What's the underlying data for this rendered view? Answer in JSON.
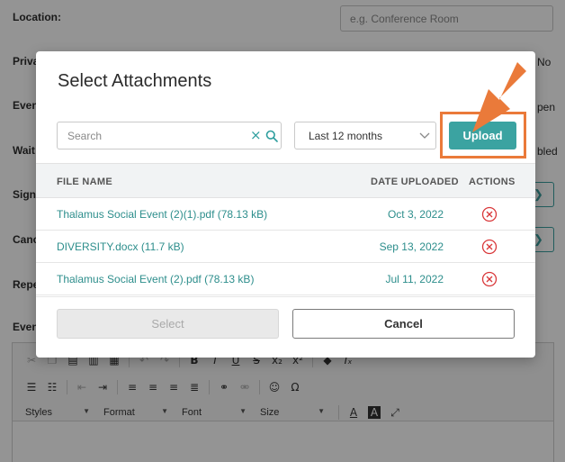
{
  "background": {
    "location_label": "Location:",
    "location_placeholder": "e.g. Conference Room",
    "labels": [
      "Priva",
      "Even",
      "Wait",
      "Sign",
      "Canc",
      "Repe",
      "Even"
    ],
    "right_texts": [
      "No",
      "pen",
      "bled"
    ],
    "editor": {
      "dropdowns": [
        "Styles",
        "Format",
        "Font",
        "Size"
      ]
    }
  },
  "modal": {
    "title": "Select Attachments",
    "search_placeholder": "Search",
    "date_filter": "Last 12 months",
    "upload_label": "Upload",
    "columns": [
      "FILE NAME",
      "DATE UPLOADED",
      "ACTIONS"
    ],
    "files": [
      {
        "name": "Thalamus Social Event (2)(1).pdf (78.13 kB)",
        "date": "Oct 3, 2022"
      },
      {
        "name": "DIVERSITY.docx (11.7 kB)",
        "date": "Sep 13, 2022"
      },
      {
        "name": "Thalamus Social Event (2).pdf (78.13 kB)",
        "date": "Jul 11, 2022"
      }
    ],
    "select_label": "Select",
    "cancel_label": "Cancel"
  },
  "colors": {
    "accent": "#3ba3a1",
    "link": "#2d8e8c",
    "delete": "#d9383a",
    "highlight": "#ea7a3a"
  }
}
